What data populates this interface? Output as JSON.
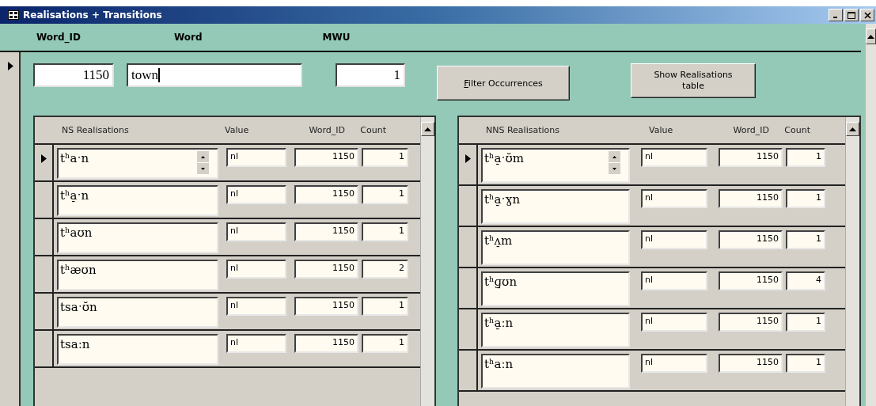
{
  "window": {
    "title": "Realisations + Transitions"
  },
  "header": [
    "Word_ID",
    "Word",
    "MWU"
  ],
  "record": {
    "selected": true,
    "word_id": "1150",
    "word": "town",
    "mwu": "1"
  },
  "buttons": [
    {
      "label": "Filter Occurrences",
      "first_letter_underlined": true
    },
    {
      "label": "Show Realisations table",
      "first_letter_underlined": false
    }
  ],
  "subforms": [
    {
      "columns": [
        "NS Realisations",
        "Value",
        "Word_ID",
        "Count"
      ],
      "rows": [
        {
          "realisation": "tʰaˑn",
          "value": "nl",
          "word_id": "1150",
          "count": "1",
          "selected": true
        },
        {
          "realisation": "tʰa̠ˑn",
          "value": "nl",
          "word_id": "1150",
          "count": "1",
          "selected": false
        },
        {
          "realisation": "tʰaʊn",
          "value": "nl",
          "word_id": "1150",
          "count": "1",
          "selected": false
        },
        {
          "realisation": "tʰæʊn",
          "value": "nl",
          "word_id": "1150",
          "count": "2",
          "selected": false
        },
        {
          "realisation": "tsaˑʊ̆n",
          "value": "nl",
          "word_id": "1150",
          "count": "1",
          "selected": false
        },
        {
          "realisation": "tsaːn",
          "value": "nl",
          "word_id": "1150",
          "count": "1",
          "selected": false
        }
      ]
    },
    {
      "columns": [
        "NNS Realisations",
        "Value",
        "Word_ID",
        "Count"
      ],
      "rows": [
        {
          "realisation": "tʰa̠ˑʊ̆m",
          "value": "nl",
          "word_id": "1150",
          "count": "1",
          "selected": true
        },
        {
          "realisation": "tʰa̠ˑɣn",
          "value": "nl",
          "word_id": "1150",
          "count": "1",
          "selected": false
        },
        {
          "realisation": "tʰʌ̠m",
          "value": "nl",
          "word_id": "1150",
          "count": "1",
          "selected": false
        },
        {
          "realisation": "tʰɡ̠ʊn",
          "value": "nl",
          "word_id": "1150",
          "count": "4",
          "selected": false
        },
        {
          "realisation": "tʰa̠ːn",
          "value": "nl",
          "word_id": "1150",
          "count": "1",
          "selected": false
        },
        {
          "realisation": "tʰaːn",
          "value": "nl",
          "word_id": "1150",
          "count": "1",
          "selected": false
        }
      ]
    }
  ]
}
